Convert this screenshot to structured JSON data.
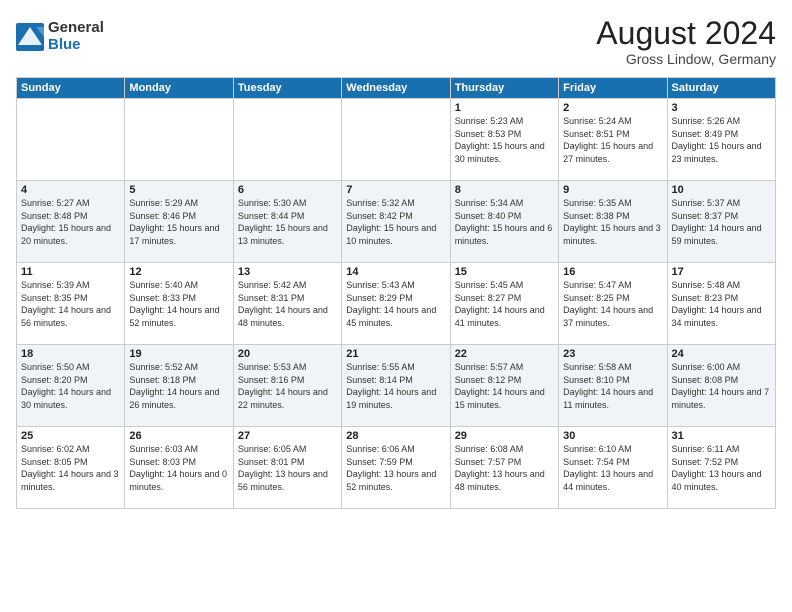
{
  "logo": {
    "general": "General",
    "blue": "Blue"
  },
  "header": {
    "month": "August 2024",
    "location": "Gross Lindow, Germany"
  },
  "weekdays": [
    "Sunday",
    "Monday",
    "Tuesday",
    "Wednesday",
    "Thursday",
    "Friday",
    "Saturday"
  ],
  "weeks": [
    [
      {
        "day": "",
        "sunrise": "",
        "sunset": "",
        "daylight": ""
      },
      {
        "day": "",
        "sunrise": "",
        "sunset": "",
        "daylight": ""
      },
      {
        "day": "",
        "sunrise": "",
        "sunset": "",
        "daylight": ""
      },
      {
        "day": "",
        "sunrise": "",
        "sunset": "",
        "daylight": ""
      },
      {
        "day": "1",
        "sunrise": "Sunrise: 5:23 AM",
        "sunset": "Sunset: 8:53 PM",
        "daylight": "Daylight: 15 hours and 30 minutes."
      },
      {
        "day": "2",
        "sunrise": "Sunrise: 5:24 AM",
        "sunset": "Sunset: 8:51 PM",
        "daylight": "Daylight: 15 hours and 27 minutes."
      },
      {
        "day": "3",
        "sunrise": "Sunrise: 5:26 AM",
        "sunset": "Sunset: 8:49 PM",
        "daylight": "Daylight: 15 hours and 23 minutes."
      }
    ],
    [
      {
        "day": "4",
        "sunrise": "Sunrise: 5:27 AM",
        "sunset": "Sunset: 8:48 PM",
        "daylight": "Daylight: 15 hours and 20 minutes."
      },
      {
        "day": "5",
        "sunrise": "Sunrise: 5:29 AM",
        "sunset": "Sunset: 8:46 PM",
        "daylight": "Daylight: 15 hours and 17 minutes."
      },
      {
        "day": "6",
        "sunrise": "Sunrise: 5:30 AM",
        "sunset": "Sunset: 8:44 PM",
        "daylight": "Daylight: 15 hours and 13 minutes."
      },
      {
        "day": "7",
        "sunrise": "Sunrise: 5:32 AM",
        "sunset": "Sunset: 8:42 PM",
        "daylight": "Daylight: 15 hours and 10 minutes."
      },
      {
        "day": "8",
        "sunrise": "Sunrise: 5:34 AM",
        "sunset": "Sunset: 8:40 PM",
        "daylight": "Daylight: 15 hours and 6 minutes."
      },
      {
        "day": "9",
        "sunrise": "Sunrise: 5:35 AM",
        "sunset": "Sunset: 8:38 PM",
        "daylight": "Daylight: 15 hours and 3 minutes."
      },
      {
        "day": "10",
        "sunrise": "Sunrise: 5:37 AM",
        "sunset": "Sunset: 8:37 PM",
        "daylight": "Daylight: 14 hours and 59 minutes."
      }
    ],
    [
      {
        "day": "11",
        "sunrise": "Sunrise: 5:39 AM",
        "sunset": "Sunset: 8:35 PM",
        "daylight": "Daylight: 14 hours and 56 minutes."
      },
      {
        "day": "12",
        "sunrise": "Sunrise: 5:40 AM",
        "sunset": "Sunset: 8:33 PM",
        "daylight": "Daylight: 14 hours and 52 minutes."
      },
      {
        "day": "13",
        "sunrise": "Sunrise: 5:42 AM",
        "sunset": "Sunset: 8:31 PM",
        "daylight": "Daylight: 14 hours and 48 minutes."
      },
      {
        "day": "14",
        "sunrise": "Sunrise: 5:43 AM",
        "sunset": "Sunset: 8:29 PM",
        "daylight": "Daylight: 14 hours and 45 minutes."
      },
      {
        "day": "15",
        "sunrise": "Sunrise: 5:45 AM",
        "sunset": "Sunset: 8:27 PM",
        "daylight": "Daylight: 14 hours and 41 minutes."
      },
      {
        "day": "16",
        "sunrise": "Sunrise: 5:47 AM",
        "sunset": "Sunset: 8:25 PM",
        "daylight": "Daylight: 14 hours and 37 minutes."
      },
      {
        "day": "17",
        "sunrise": "Sunrise: 5:48 AM",
        "sunset": "Sunset: 8:23 PM",
        "daylight": "Daylight: 14 hours and 34 minutes."
      }
    ],
    [
      {
        "day": "18",
        "sunrise": "Sunrise: 5:50 AM",
        "sunset": "Sunset: 8:20 PM",
        "daylight": "Daylight: 14 hours and 30 minutes."
      },
      {
        "day": "19",
        "sunrise": "Sunrise: 5:52 AM",
        "sunset": "Sunset: 8:18 PM",
        "daylight": "Daylight: 14 hours and 26 minutes."
      },
      {
        "day": "20",
        "sunrise": "Sunrise: 5:53 AM",
        "sunset": "Sunset: 8:16 PM",
        "daylight": "Daylight: 14 hours and 22 minutes."
      },
      {
        "day": "21",
        "sunrise": "Sunrise: 5:55 AM",
        "sunset": "Sunset: 8:14 PM",
        "daylight": "Daylight: 14 hours and 19 minutes."
      },
      {
        "day": "22",
        "sunrise": "Sunrise: 5:57 AM",
        "sunset": "Sunset: 8:12 PM",
        "daylight": "Daylight: 14 hours and 15 minutes."
      },
      {
        "day": "23",
        "sunrise": "Sunrise: 5:58 AM",
        "sunset": "Sunset: 8:10 PM",
        "daylight": "Daylight: 14 hours and 11 minutes."
      },
      {
        "day": "24",
        "sunrise": "Sunrise: 6:00 AM",
        "sunset": "Sunset: 8:08 PM",
        "daylight": "Daylight: 14 hours and 7 minutes."
      }
    ],
    [
      {
        "day": "25",
        "sunrise": "Sunrise: 6:02 AM",
        "sunset": "Sunset: 8:05 PM",
        "daylight": "Daylight: 14 hours and 3 minutes."
      },
      {
        "day": "26",
        "sunrise": "Sunrise: 6:03 AM",
        "sunset": "Sunset: 8:03 PM",
        "daylight": "Daylight: 14 hours and 0 minutes."
      },
      {
        "day": "27",
        "sunrise": "Sunrise: 6:05 AM",
        "sunset": "Sunset: 8:01 PM",
        "daylight": "Daylight: 13 hours and 56 minutes."
      },
      {
        "day": "28",
        "sunrise": "Sunrise: 6:06 AM",
        "sunset": "Sunset: 7:59 PM",
        "daylight": "Daylight: 13 hours and 52 minutes."
      },
      {
        "day": "29",
        "sunrise": "Sunrise: 6:08 AM",
        "sunset": "Sunset: 7:57 PM",
        "daylight": "Daylight: 13 hours and 48 minutes."
      },
      {
        "day": "30",
        "sunrise": "Sunrise: 6:10 AM",
        "sunset": "Sunset: 7:54 PM",
        "daylight": "Daylight: 13 hours and 44 minutes."
      },
      {
        "day": "31",
        "sunrise": "Sunrise: 6:11 AM",
        "sunset": "Sunset: 7:52 PM",
        "daylight": "Daylight: 13 hours and 40 minutes."
      }
    ]
  ]
}
